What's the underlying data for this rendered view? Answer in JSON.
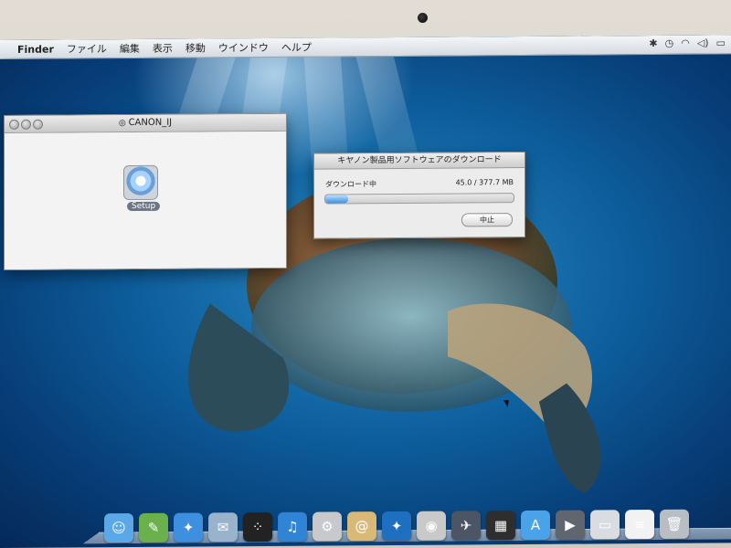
{
  "menubar": {
    "apple_icon": "apple-icon",
    "items": [
      "Finder",
      "ファイル",
      "編集",
      "表示",
      "移動",
      "ウインドウ",
      "ヘルプ"
    ],
    "status_icons": [
      "bluetooth-icon",
      "time-machine-icon",
      "wifi-icon",
      "volume-icon",
      "battery-icon"
    ]
  },
  "finder_window": {
    "title": "CANON_IJ",
    "items": [
      {
        "label": "Setup",
        "icon": "installer-disc-icon"
      }
    ]
  },
  "download_dialog": {
    "title": "キヤノン製品用ソフトウェアのダウンロード",
    "status_label": "ダウンロード中",
    "progress_text": "45.0 / 377.7 MB",
    "progress_fraction": 0.119,
    "stop_button": "中止"
  },
  "dock": {
    "apps": [
      {
        "name": "finder-icon",
        "color": "#5aa8e8",
        "glyph": "☺"
      },
      {
        "name": "evernote-icon",
        "color": "#6ab04c",
        "glyph": "✎"
      },
      {
        "name": "safari-icon",
        "color": "#3d8fe0",
        "glyph": "✦"
      },
      {
        "name": "preview-icon",
        "color": "#9ab3cc",
        "glyph": "✉"
      },
      {
        "name": "blackberry-icon",
        "color": "#222222",
        "glyph": "⁘"
      },
      {
        "name": "itunes-icon",
        "color": "#2f84d6",
        "glyph": "♫"
      },
      {
        "name": "network-icon",
        "color": "#c7c9cc",
        "glyph": "⚙"
      },
      {
        "name": "contacts-icon",
        "color": "#d8b978",
        "glyph": "@"
      },
      {
        "name": "safari-icon",
        "color": "#1f6fc0",
        "glyph": "✦"
      },
      {
        "name": "photo-booth-icon",
        "color": "#c9c9c9",
        "glyph": "◉"
      },
      {
        "name": "launchpad-icon",
        "color": "#4b5563",
        "glyph": "✈"
      },
      {
        "name": "mission-control-icon",
        "color": "#2e2e2e",
        "glyph": "▦"
      },
      {
        "name": "app-store-icon",
        "color": "#4aa3e8",
        "glyph": "A"
      },
      {
        "name": "facetime-icon",
        "color": "#5f6670",
        "glyph": "▶"
      },
      {
        "name": "folder-icon",
        "color": "#d9dde2",
        "glyph": "▭"
      },
      {
        "name": "document-icon",
        "color": "#f2f2f2",
        "glyph": "≡"
      },
      {
        "name": "trash-icon",
        "color": "#b9bec5",
        "glyph": "🗑"
      }
    ]
  }
}
